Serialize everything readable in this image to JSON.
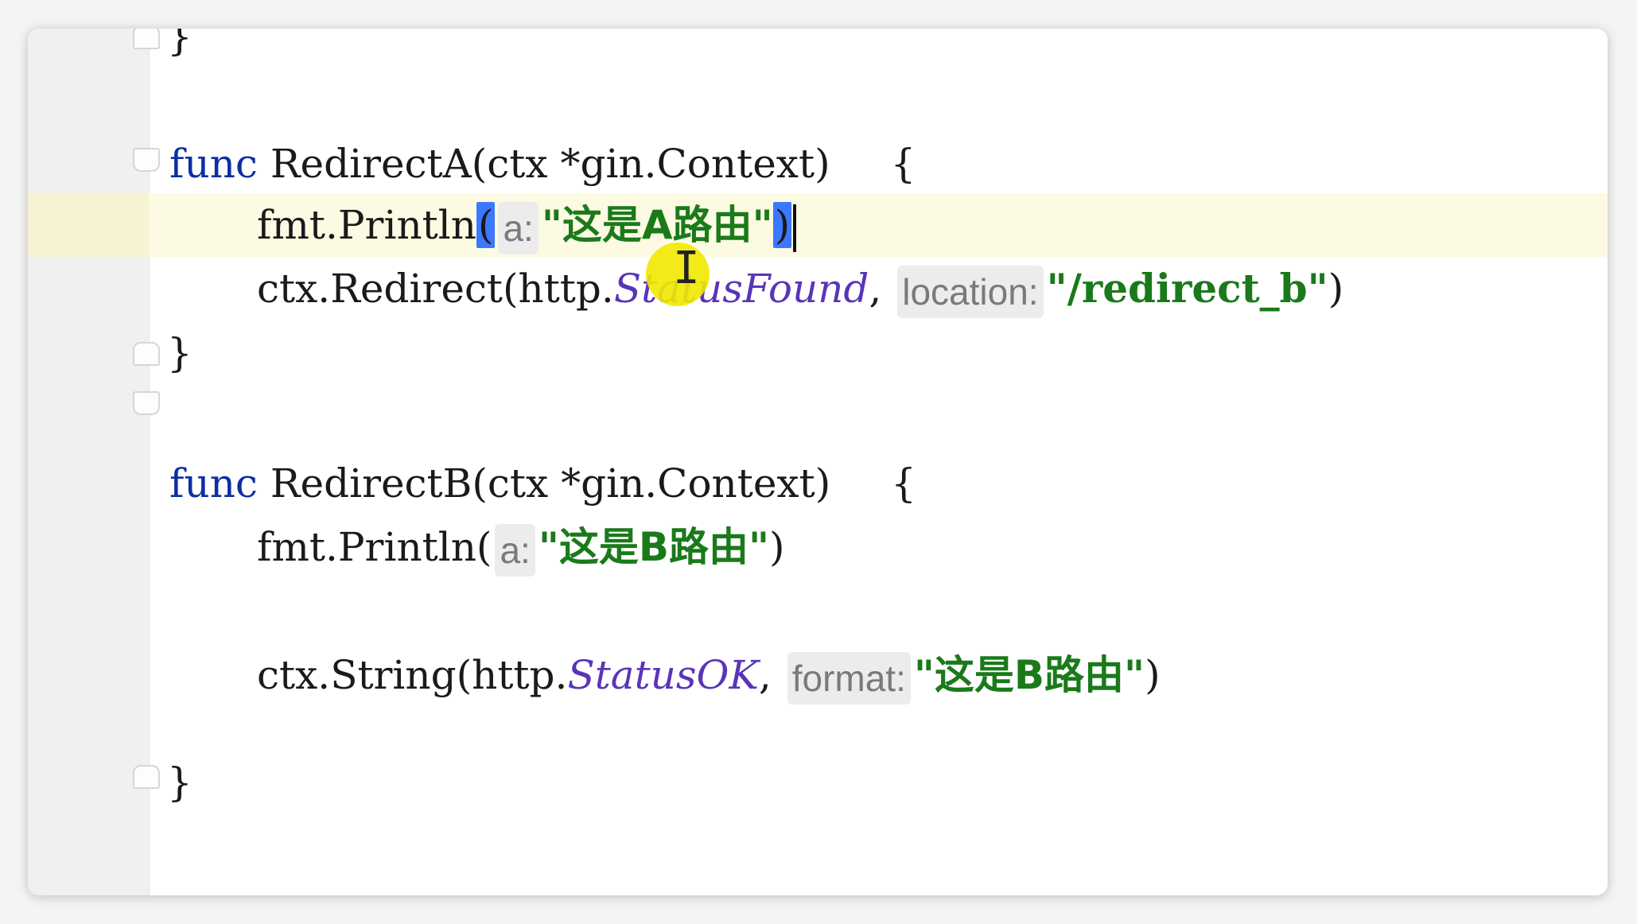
{
  "editor": {
    "top_brace": "}",
    "func_a": {
      "keyword": "func",
      "signature": "RedirectA(ctx *gin.Context)",
      "open_brace": "{",
      "println_prefix": "fmt.Println",
      "println_open": "(",
      "println_hint": "a:",
      "println_string": "\"这是A路由\"",
      "println_close": ")",
      "redirect_prefix": "ctx.Redirect(http.",
      "redirect_const": "StatusFound",
      "redirect_comma": ",",
      "redirect_hint": "location:",
      "redirect_string": "\"/redirect_b\"",
      "redirect_close": ")",
      "close_brace": "}"
    },
    "func_b": {
      "keyword": "func",
      "signature": "RedirectB(ctx *gin.Context)",
      "open_brace": "{",
      "println_prefix": "fmt.Println(",
      "println_hint": "a:",
      "println_string": "\"这是B路由\"",
      "println_close": ")",
      "string_prefix": "ctx.String(http.",
      "string_const": "StatusOK",
      "string_comma": ",",
      "string_hint": "format:",
      "string_value": "\"这是B路由\"",
      "string_close": ")",
      "close_brace": "}"
    },
    "cursor_glyph": "I"
  },
  "colors": {
    "keyword": "#0b2fa3",
    "string": "#1a7a1a",
    "constant": "#5a34b8",
    "caret_line": "#fcfae2",
    "brace_match": "#3b78ff",
    "cursor_highlight": "#f2e800"
  }
}
